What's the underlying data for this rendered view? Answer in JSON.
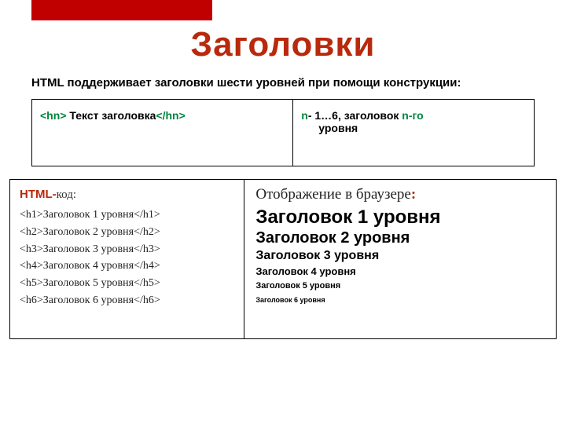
{
  "title": "Заголовки",
  "subtitle": "HTML поддерживает заголовки шести уровней при помощи конструкции:",
  "syntax": {
    "open": "<hn>",
    "text": " Текст заголовка",
    "close": "</hn>",
    "n": "n",
    "range": "- 1…6, заголовок ",
    "nth": "n-го",
    "level_word": "уровня"
  },
  "example": {
    "left_title_html": "HTML-",
    "left_title_kod": "код:",
    "right_title": "Отображение в браузере",
    "right_colon": ":",
    "lines": [
      {
        "open": "<h1>",
        "txt": "Заголовок 1 уровня",
        "close": "</h1>"
      },
      {
        "open": "<h2>",
        "txt": "Заголовок 2 уровня",
        "close": "</h2>"
      },
      {
        "open": "<h3>",
        "txt": "Заголовок 3 уровня",
        "close": "</h3>"
      },
      {
        "open": "<h4>",
        "txt": "Заголовок 4 уровня",
        "close": "</h4>"
      },
      {
        "open": "<h5>",
        "txt": "Заголовок 5 уровня",
        "close": "</h5>"
      },
      {
        "open": "<h6>",
        "txt": "Заголовок 6 уровня",
        "close": "</h6>"
      }
    ],
    "rendered": [
      "Заголовок 1 уровня",
      "Заголовок 2 уровня",
      "Заголовок 3 уровня",
      "Заголовок 4 уровня",
      "Заголовок 5 уровня",
      "Заголовок 6 уровня"
    ]
  }
}
